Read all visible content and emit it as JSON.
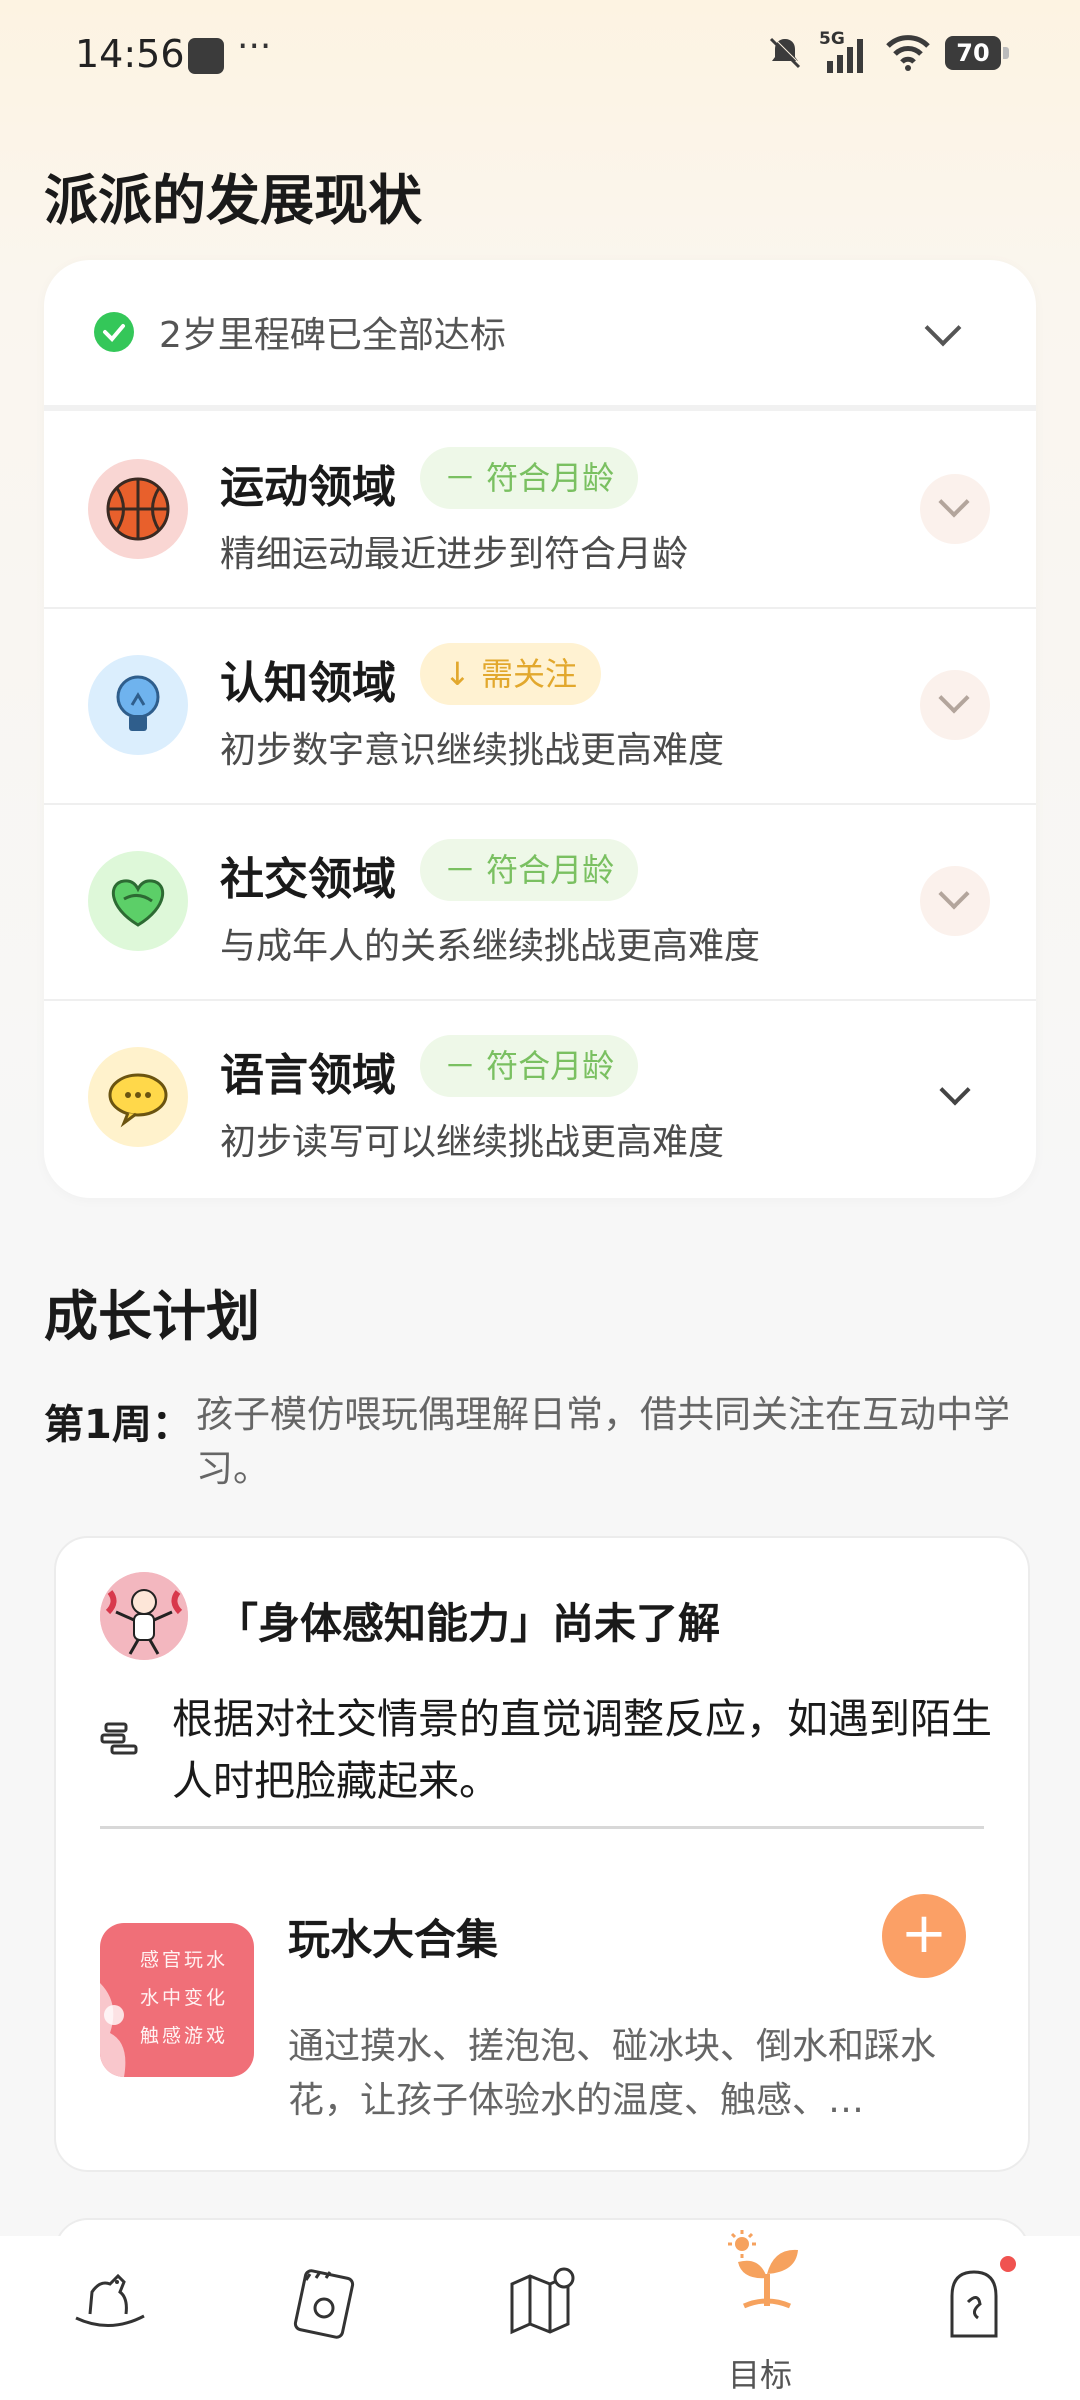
{
  "status_bar": {
    "time": "14:56",
    "dots": "···",
    "network": "5G",
    "battery": "70"
  },
  "dev_section": {
    "title": "派派的发展现状",
    "milestone": "2岁里程碑已全部达标",
    "domains": [
      {
        "title": "运动领域",
        "badge": "－ 符合月龄",
        "badge_type": "green",
        "desc": "精细运动最近进步到符合月龄",
        "icon": "basketball-icon",
        "color": "#f9d6d3"
      },
      {
        "title": "认知领域",
        "badge": "↓ 需关注",
        "badge_type": "yellow",
        "desc": "初步数字意识继续挑战更高难度",
        "icon": "lightbulb-icon",
        "color": "#dbeefd"
      },
      {
        "title": "社交领域",
        "badge": "－ 符合月龄",
        "badge_type": "green",
        "desc": "与成年人的关系继续挑战更高难度",
        "icon": "heart-hands-icon",
        "color": "#def8d9"
      },
      {
        "title": "语言领域",
        "badge": "－ 符合月龄",
        "badge_type": "green",
        "desc": "初步读写可以继续挑战更高难度",
        "icon": "speech-bubble-icon",
        "color": "#fff2cc"
      }
    ]
  },
  "plan_section": {
    "title": "成长计划",
    "week_label": "第1周：",
    "week_text": "孩子模仿喂玩偶理解日常，借共同关注在互动中学习。",
    "card": {
      "title": "「身体感知能力」尚未了解",
      "text": "根据对社交情景的直觉调整反应，如遇到陌生人时把脸藏起来。",
      "activity_name": "玩水大合集",
      "thumb_text": "感官玩水 水中变化 触感游戏",
      "activity_desc": "通过摸水、搓泡泡、碰冰块、倒水和踩水花，让孩子体验水的温度、触感、…",
      "add_label": "+"
    }
  },
  "tab_bar": {
    "tabs": [
      {
        "icon": "rocking-horse-icon"
      },
      {
        "icon": "notebook-icon"
      },
      {
        "icon": "map-icon"
      },
      {
        "icon": "sprout-icon",
        "label": "目标",
        "active": true
      },
      {
        "icon": "ghost-icon",
        "has_dot": true
      }
    ],
    "accent": "#f6a25e"
  }
}
